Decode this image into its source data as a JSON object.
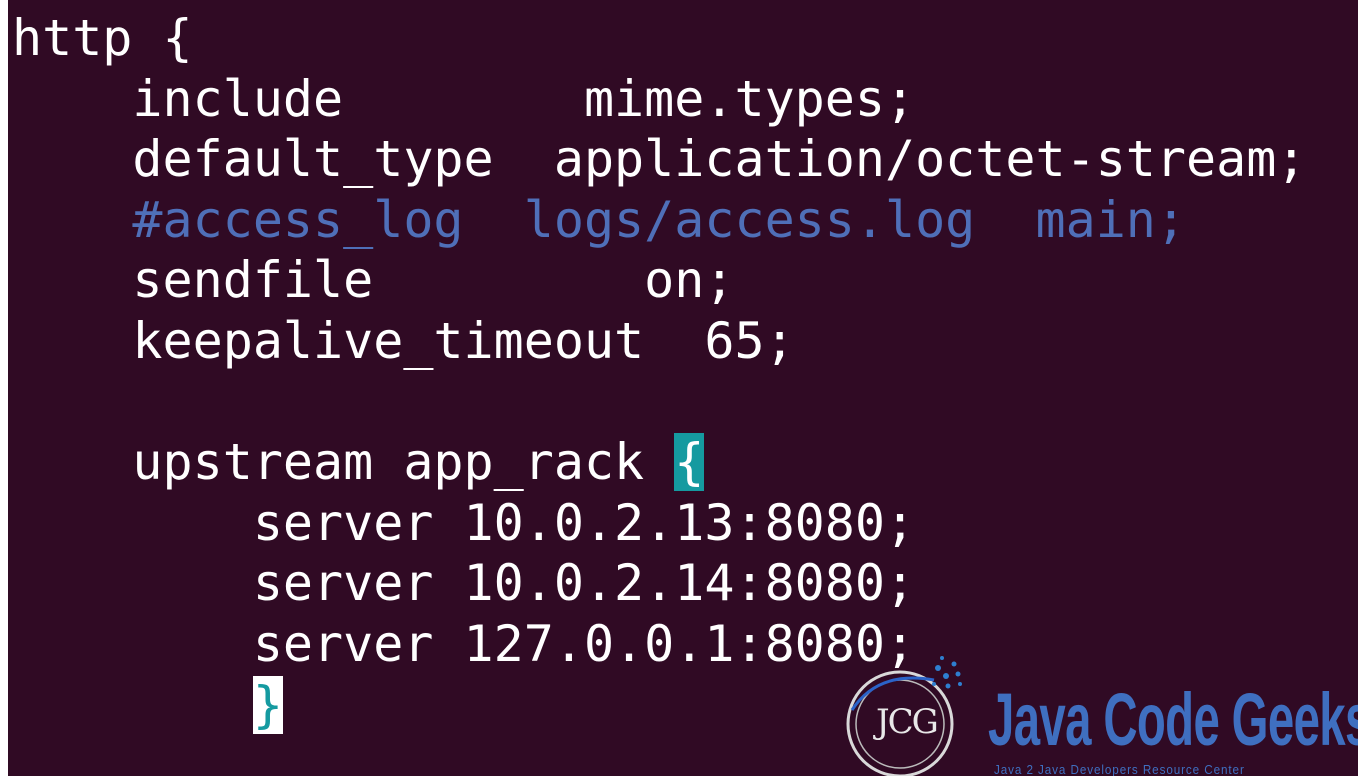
{
  "editor": {
    "lines": [
      {
        "segments": [
          {
            "text": "http {"
          }
        ]
      },
      {
        "segments": [
          {
            "text": "    include        mime.types;"
          }
        ]
      },
      {
        "segments": [
          {
            "text": "    default_type  application/octet-stream;"
          }
        ]
      },
      {
        "segments": [
          {
            "text": "    #access_log  logs/access.log  main;",
            "style": "comment"
          }
        ]
      },
      {
        "segments": [
          {
            "text": "    sendfile         on;"
          }
        ]
      },
      {
        "segments": [
          {
            "text": "    keepalive_timeout  65;"
          }
        ]
      },
      {
        "segments": [
          {
            "text": ""
          }
        ]
      },
      {
        "segments": [
          {
            "text": "    upstream app_rack "
          },
          {
            "text": "{",
            "style": "brace-hl"
          }
        ]
      },
      {
        "segments": [
          {
            "text": "        server 10.0.2.13:8080;"
          }
        ]
      },
      {
        "segments": [
          {
            "text": "        server 10.0.2.14:8080;"
          }
        ]
      },
      {
        "segments": [
          {
            "text": "        server 127.0.0.1:8080;"
          }
        ]
      },
      {
        "segments": [
          {
            "text": "        "
          },
          {
            "text": "}",
            "style": "cursor-block"
          }
        ]
      }
    ]
  },
  "watermark": {
    "logo_text": "JCG",
    "brand_name": "Java Code Geeks",
    "tagline": "Java 2 Java Developers Resource Center",
    "brand_color": "#3f6fc0"
  },
  "colors": {
    "background": "#300a24",
    "text": "#ffffff",
    "comment": "#4f6fb8",
    "brace_highlight": "#159aa0"
  }
}
